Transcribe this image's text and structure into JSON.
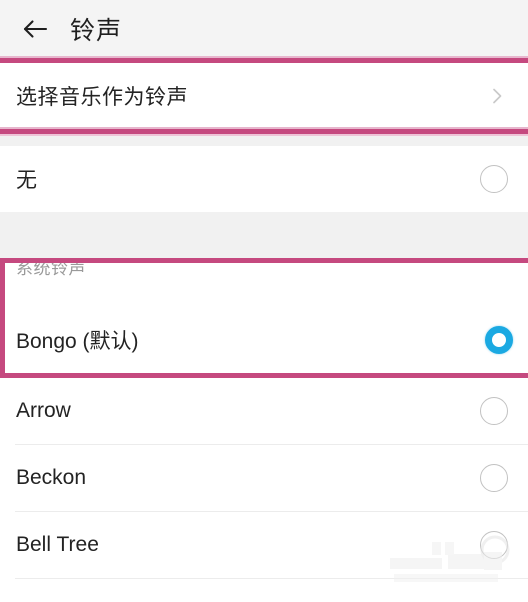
{
  "header": {
    "title": "铃声",
    "back_icon": "arrow-left-icon"
  },
  "colors": {
    "accent_magenta": "#c5497f",
    "selected_radio_blue": "#1ba9e2",
    "unselected_radio_gray": "#c2c2c2",
    "page_background": "#ffffff",
    "group_gap_gray": "#f1f1f1",
    "title_bar_gray": "#f4f4f4"
  },
  "pick_music": {
    "label": "选择音乐作为铃声",
    "chevron_icon": "chevron-right-icon"
  },
  "none_row": {
    "label": "无",
    "selected": false
  },
  "system_section": {
    "header": "系统铃声",
    "items": [
      {
        "label": "Bongo (默认)",
        "selected": true
      },
      {
        "label": "Arrow",
        "selected": false
      },
      {
        "label": "Beckon",
        "selected": false
      },
      {
        "label": "Bell Tree",
        "selected": false
      }
    ]
  },
  "watermark": {
    "text": ""
  }
}
